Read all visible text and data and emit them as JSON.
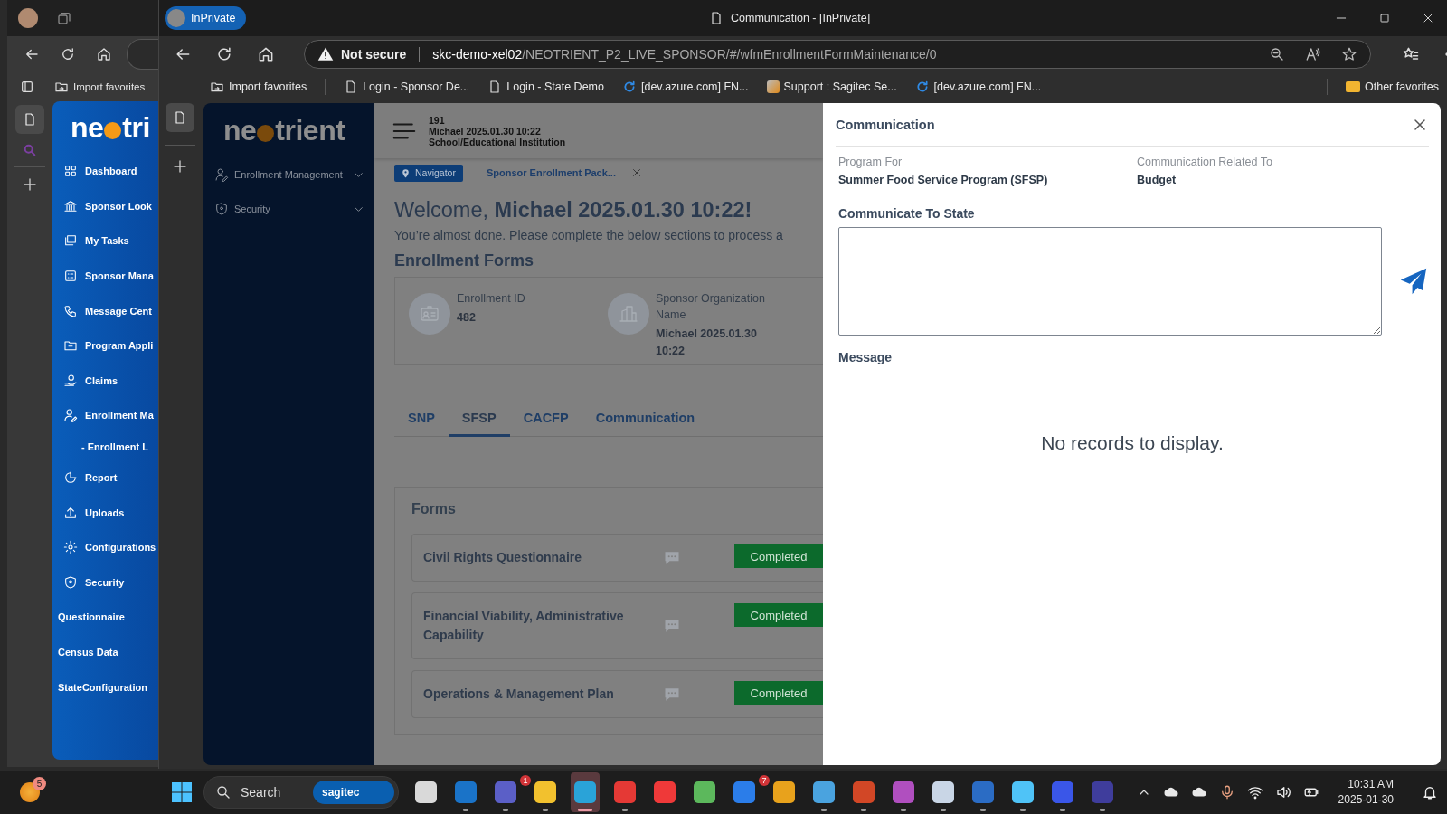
{
  "back_window": {
    "bookmark": "Import favorites",
    "logo": {
      "left": "ne",
      "right": "tri"
    },
    "menu": [
      {
        "label": "Dashboard",
        "kind": "icon"
      },
      {
        "label": "Sponsor Look",
        "kind": "icon"
      },
      {
        "label": "My Tasks",
        "kind": "icon"
      },
      {
        "label": "Sponsor Mana",
        "kind": "icon"
      },
      {
        "label": "Message Cent",
        "kind": "icon"
      },
      {
        "label": "Program Appli",
        "kind": "icon"
      },
      {
        "label": "Claims",
        "kind": "icon"
      },
      {
        "label": "Enrollment Ma",
        "kind": "icon"
      },
      {
        "label": "- Enrollment L",
        "kind": "sub"
      },
      {
        "label": "Report",
        "kind": "icon"
      },
      {
        "label": "Uploads",
        "kind": "icon"
      },
      {
        "label": "Configurations",
        "kind": "icon"
      },
      {
        "label": "Security",
        "kind": "icon"
      },
      {
        "label": "Questionnaire",
        "kind": "plain"
      },
      {
        "label": "Census Data",
        "kind": "plain"
      },
      {
        "label": "StateConfiguration",
        "kind": "plain"
      }
    ]
  },
  "window": {
    "profile": "InPrivate",
    "title": "Communication - [InPrivate]",
    "address": {
      "warning": "Not secure",
      "host": "skc-demo-xel02",
      "path": "/NEOTRIENT_P2_LIVE_SPONSOR/#/wfmEnrollmentFormMaintenance/0"
    },
    "bookmarks": [
      {
        "label": "Import favorites",
        "kind": "import"
      },
      {
        "label": "Login - Sponsor De...",
        "kind": "page"
      },
      {
        "label": "Login - State Demo",
        "kind": "page"
      },
      {
        "label": "[dev.azure.com] FN...",
        "kind": "azure"
      },
      {
        "label": "Support : Sagitec Se...",
        "kind": "support"
      },
      {
        "label": "[dev.azure.com] FN...",
        "kind": "azure"
      }
    ],
    "other_favorites": "Other favorites"
  },
  "app": {
    "logo": {
      "left": "ne",
      "right": "trient"
    },
    "nav": [
      {
        "label": "Enrollment Management",
        "expanded": false
      },
      {
        "label": "Security",
        "expanded": false
      }
    ],
    "header": {
      "id": "191",
      "name": "Michael 2025.01.30 10:22",
      "org_type": "School/Educational Institution"
    },
    "breadcrumb": {
      "navigator": "Navigator",
      "page": "Sponsor Enrollment Pack..."
    },
    "welcome": "Welcome, **Michael 2025.01.30 10:22!**",
    "intro": "You’re almost done. Please complete the below sections to process a",
    "section_title": "Enrollment Forms",
    "info": [
      {
        "label": "Enrollment ID",
        "value": "482"
      },
      {
        "label": "Sponsor Organization Name",
        "value": "Michael 2025.01.30 10:22"
      }
    ],
    "tabs": [
      {
        "label": "SNP",
        "selected": false
      },
      {
        "label": "SFSP",
        "selected": true
      },
      {
        "label": "CACFP",
        "selected": false
      },
      {
        "label": "Communication",
        "selected": false
      }
    ],
    "forms": {
      "title": "Forms",
      "rows": [
        {
          "name": "Civil Rights Questionnaire",
          "status": "Completed"
        },
        {
          "name": "Financial Viability, Administrative Capability",
          "status": "Completed"
        },
        {
          "name": "Operations & Management Plan",
          "status": "Completed"
        }
      ]
    }
  },
  "panel": {
    "title": "Communication",
    "program_label": "Program For",
    "program": "Summer Food Service Program (SFSP)",
    "related_label": "Communication Related To",
    "related": "Budget",
    "input_label": "Communicate To State",
    "message_label": "Message",
    "empty": "No records to display."
  },
  "taskbar": {
    "weather_badge": "5",
    "search": "Search",
    "search_brand": "sagitec",
    "apps": [
      {
        "running": false,
        "active": false
      },
      {
        "running": true,
        "active": false
      },
      {
        "running": true,
        "active": false,
        "badge": "1"
      },
      {
        "running": true,
        "active": false
      },
      {
        "running": true,
        "active": true
      },
      {
        "running": true,
        "active": false
      },
      {
        "running": false,
        "active": false
      },
      {
        "running": false,
        "active": false
      },
      {
        "running": false,
        "active": false,
        "badge": "7"
      },
      {
        "running": false,
        "active": false
      },
      {
        "running": true,
        "active": false
      },
      {
        "running": true,
        "active": false
      },
      {
        "running": true,
        "active": false
      },
      {
        "running": true,
        "active": false
      },
      {
        "running": true,
        "active": false
      },
      {
        "running": true,
        "active": false
      },
      {
        "running": true,
        "active": false
      },
      {
        "running": true,
        "active": false
      }
    ],
    "time": "10:31 AM",
    "date": "2025-01-30"
  }
}
